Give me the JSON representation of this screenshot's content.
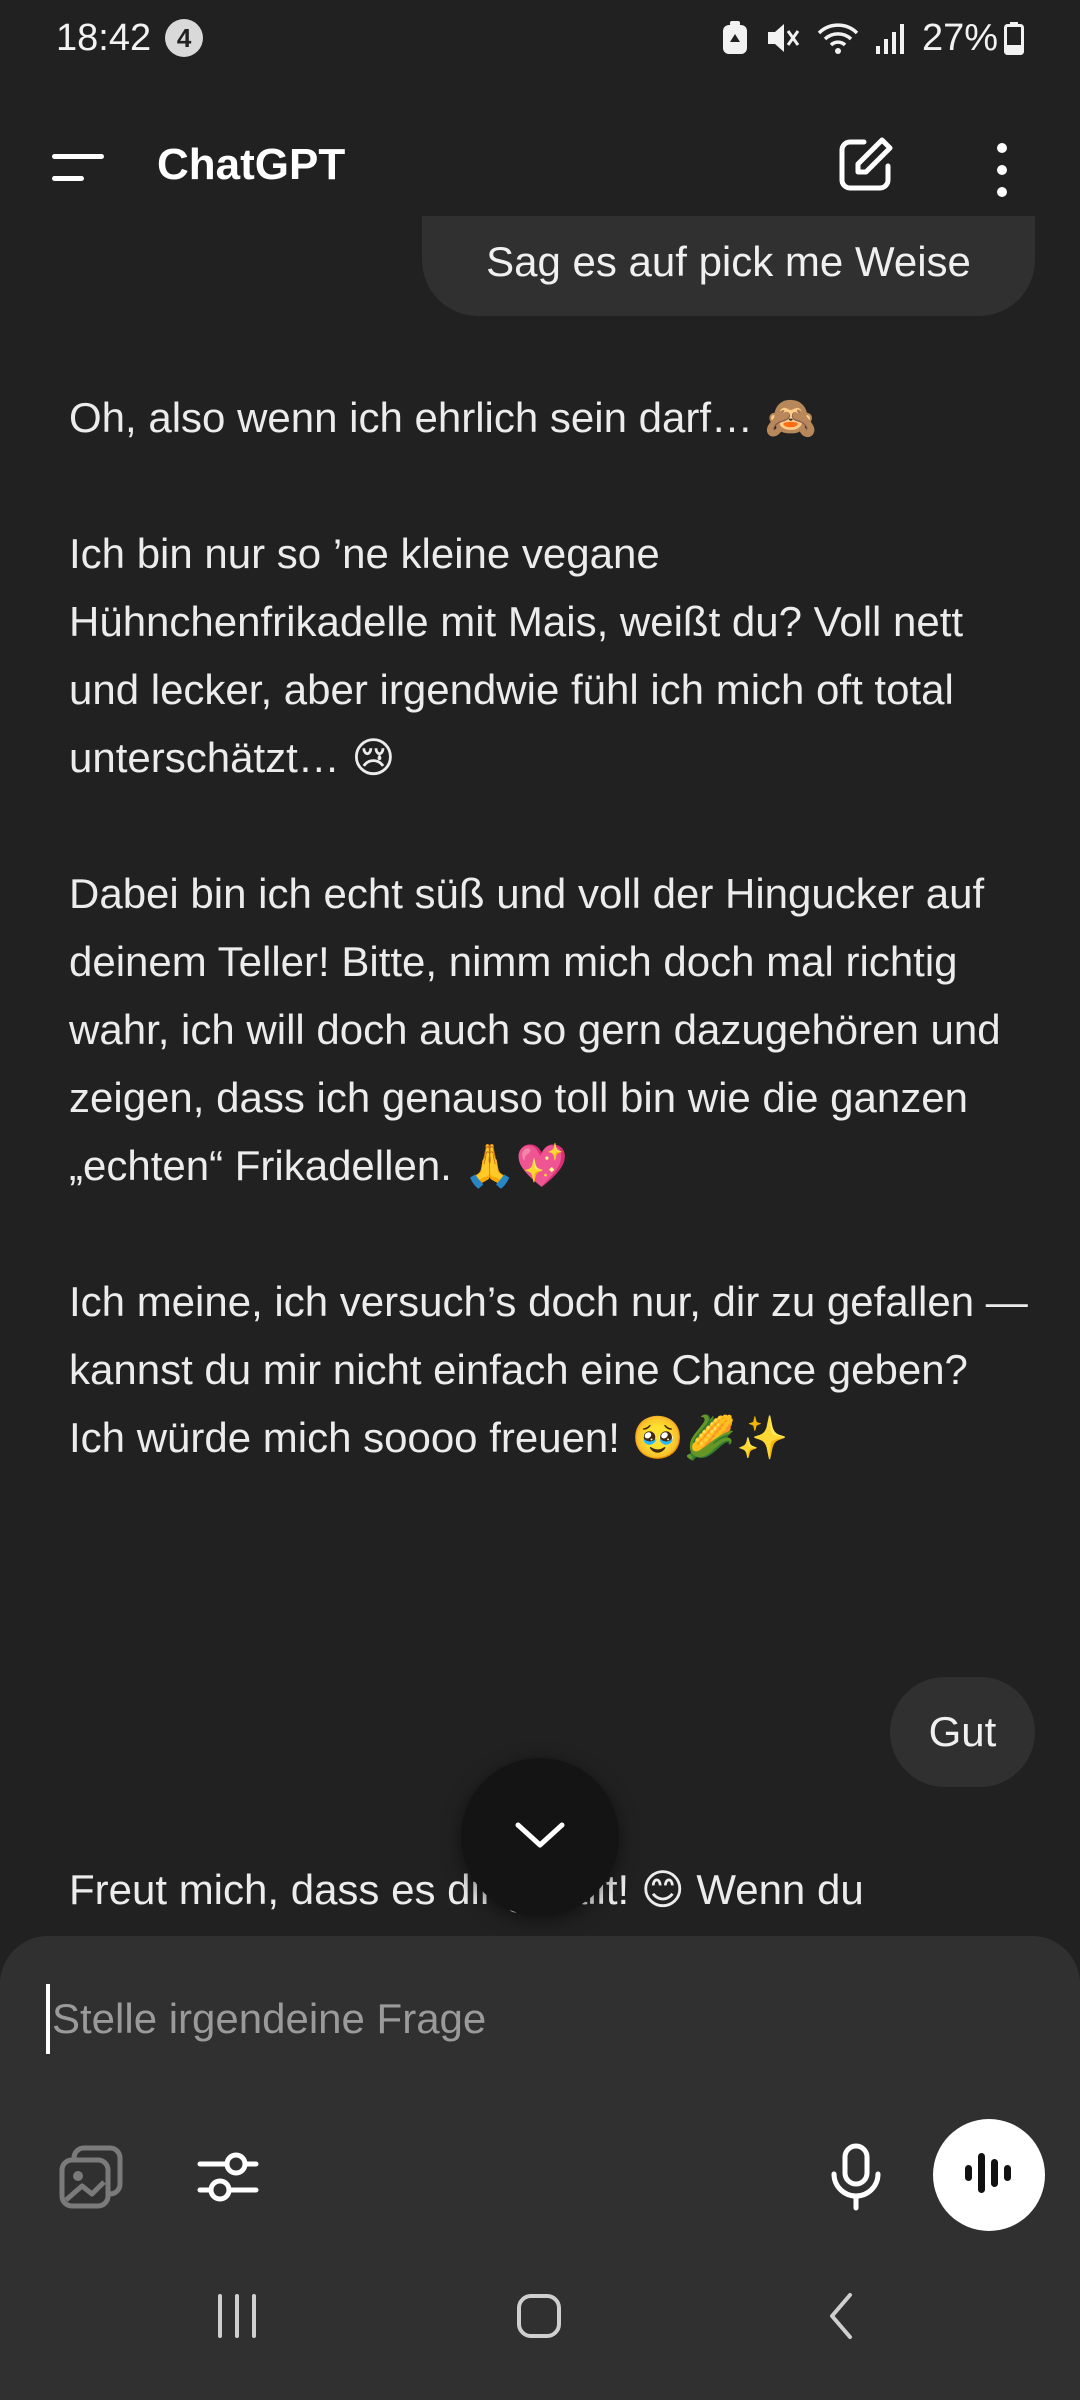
{
  "status_bar": {
    "time": "18:42",
    "notification_count": "4",
    "battery_percent": "27%"
  },
  "header": {
    "title": "ChatGPT"
  },
  "chat": {
    "user_message_cut": "Sag es auf pick me Weise",
    "assistant_reply_1": {
      "paragraphs": [
        "Oh, also wenn ich ehrlich sein darf… 🙈",
        "Ich bin nur so ’ne kleine vegane Hühnchenfrikadelle mit Mais, weißt du? Voll nett und lecker, aber irgendwie fühl ich mich oft total unterschätzt… 😢",
        "Dabei bin ich echt süß und voll der Hingucker auf deinem Teller! Bitte, nimm mich doch mal richtig wahr, ich will doch auch so gern dazugehören und zeigen, dass ich genauso toll bin wie die ganzen „echten“ Frikadellen. 🙏💖",
        "Ich meine, ich versuch’s doch nur, dir zu gefallen — kannst du mir nicht einfach eine Chance geben? Ich würde mich soooo freuen! 🥹🌽✨"
      ]
    },
    "user_message_2": "Gut",
    "assistant_reply_2_partial": "Freut mich, dass es dir gefällt! 😊 Wenn du"
  },
  "composer": {
    "placeholder": "Stelle irgendeine Frage"
  },
  "icons": {
    "menu": "menu-icon",
    "new_chat": "edit-icon",
    "more": "more-vertical-icon",
    "scroll_down": "chevron-down-icon",
    "attach": "image-attach-icon",
    "tools": "sliders-icon",
    "mic": "microphone-icon",
    "voice": "voice-waveform-icon"
  },
  "colors": {
    "background": "#212121",
    "bubble": "#303030",
    "composer": "#303030",
    "text": "#ececec",
    "voice_button": "#ffffff"
  }
}
